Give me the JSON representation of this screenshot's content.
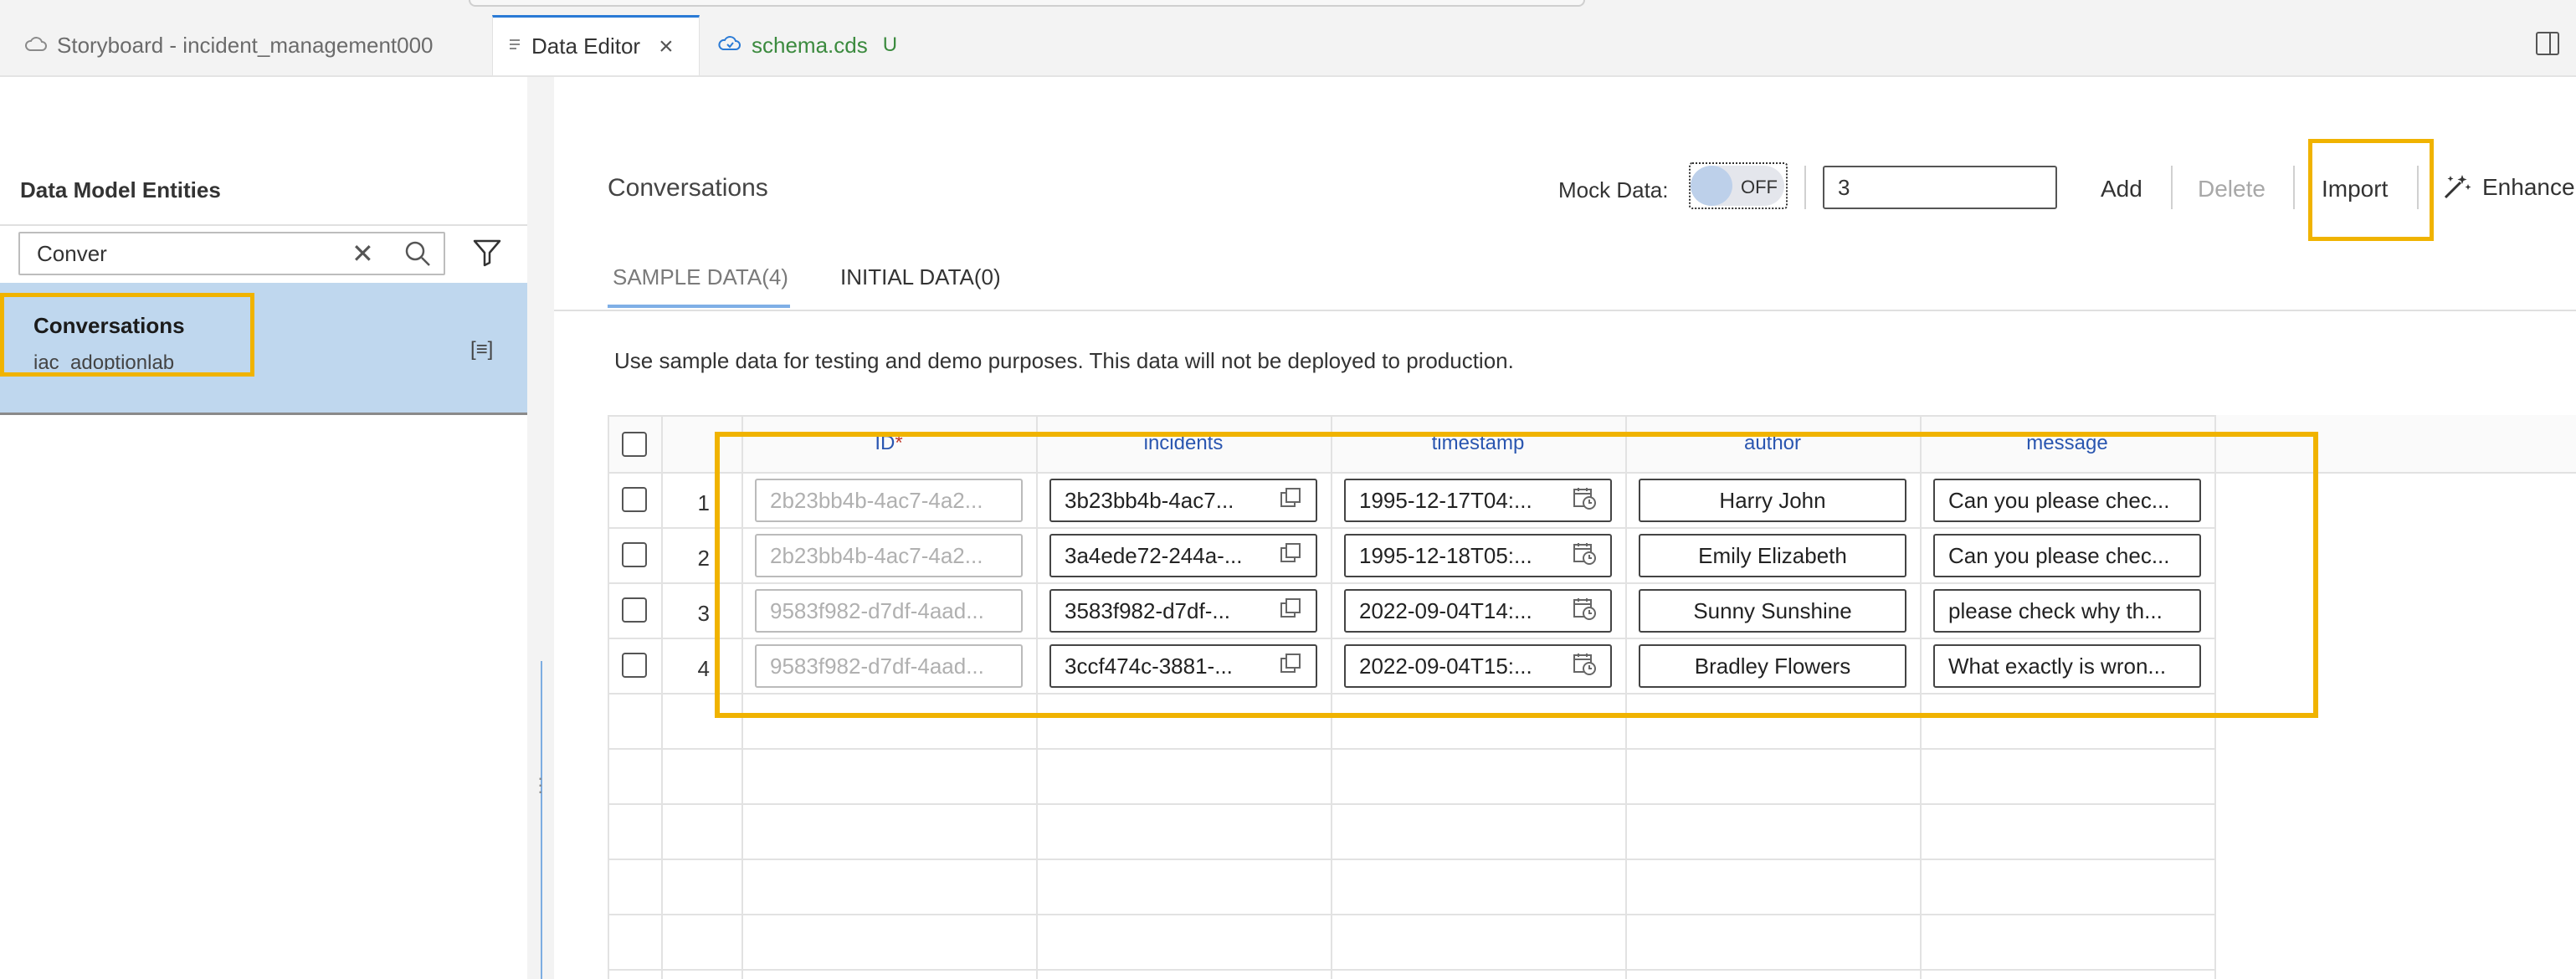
{
  "tabs": [
    {
      "label": "Storyboard - incident_management000",
      "icon": "cloud-icon"
    },
    {
      "label": "Data Editor",
      "icon": "file-icon",
      "close": "×"
    },
    {
      "label": "schema.cds",
      "icon": "cloud-schema-icon",
      "badge": "U"
    }
  ],
  "sidebar": {
    "title": "Data Model Entities",
    "search_value": "Conver",
    "items": [
      {
        "name": "Conversations",
        "sub": "iac_adoptionlab"
      }
    ]
  },
  "main": {
    "title": "Conversations",
    "mock_label": "Mock Data:",
    "toggle_text": "OFF",
    "count_value": "3",
    "add_label": "Add",
    "delete_label": "Delete",
    "import_label": "Import",
    "enhance_label": "Enhance",
    "tabs": [
      {
        "label": "SAMPLE DATA(4)"
      },
      {
        "label": "INITIAL DATA(0)"
      }
    ],
    "info": "Use sample data for testing and demo purposes. This data will not be deployed to production."
  },
  "table": {
    "columns": [
      {
        "label": "ID",
        "required": "*"
      },
      {
        "label": "incidents"
      },
      {
        "label": "timestamp"
      },
      {
        "label": "author"
      },
      {
        "label": "message"
      }
    ],
    "rows": [
      {
        "num": "1",
        "id": "2b23bb4b-4ac7-4a2...",
        "incidents": "3b23bb4b-4ac7...",
        "timestamp": "1995-12-17T04:...",
        "author": "Harry John",
        "message": "Can you please chec..."
      },
      {
        "num": "2",
        "id": "2b23bb4b-4ac7-4a2...",
        "incidents": "3a4ede72-244a-...",
        "timestamp": "1995-12-18T05:...",
        "author": "Emily Elizabeth",
        "message": "Can you please chec..."
      },
      {
        "num": "3",
        "id": "9583f982-d7df-4aad...",
        "incidents": "3583f982-d7df-...",
        "timestamp": "2022-09-04T14:...",
        "author": "Sunny Sunshine",
        "message": "please check why th..."
      },
      {
        "num": "4",
        "id": "9583f982-d7df-4aad...",
        "incidents": "3ccf474c-3881-...",
        "timestamp": "2022-09-04T15:...",
        "author": "Bradley Flowers",
        "message": "What exactly is wron..."
      }
    ]
  },
  "colors": {
    "accent": "#2a7ad5",
    "highlight": "#f0b300",
    "selected": "#bfd7ee"
  }
}
